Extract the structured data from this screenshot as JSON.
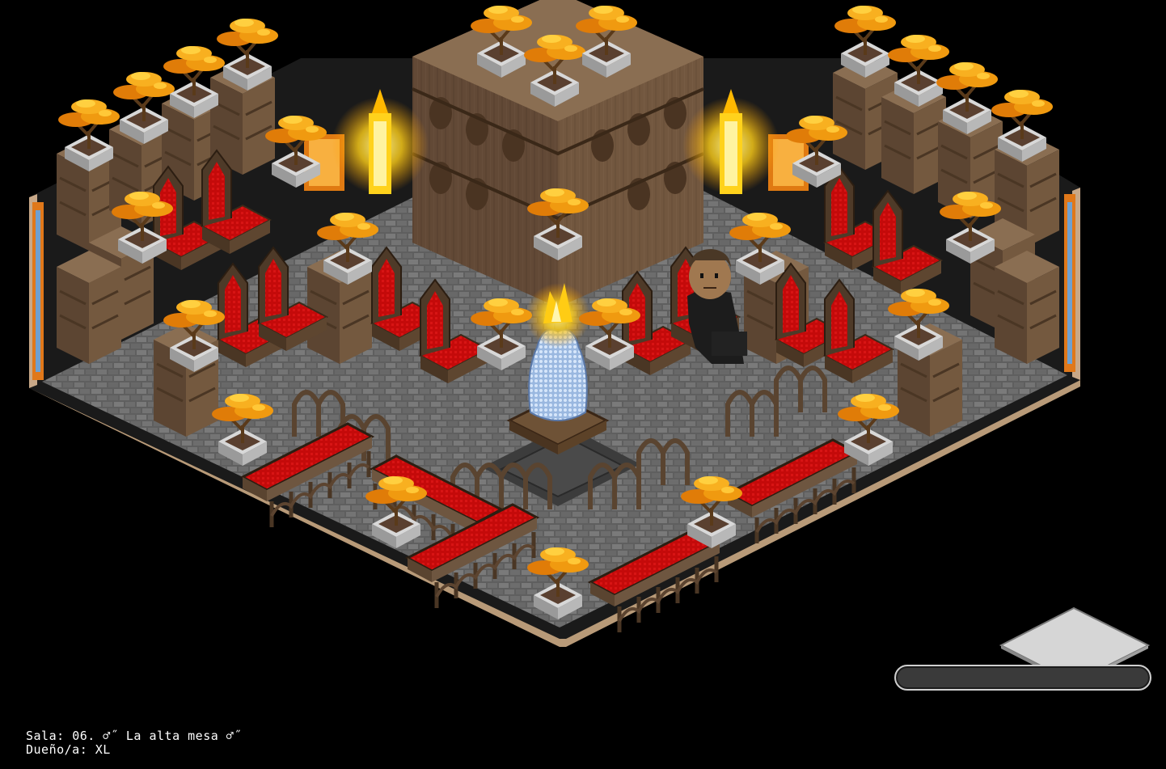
{
  "room": {
    "name_label": "Sala:",
    "name_value": "06. ♂˝ La alta mesa ♂˝",
    "owner_label": "Dueño/a:",
    "owner_value": "XL"
  },
  "colors": {
    "background": "#000000",
    "floor_stone": "#6b6b6b",
    "wood": "#6e5640",
    "velvet_red": "#c8090b",
    "bonsai_orange": "#f0a012",
    "planter_grey": "#b8b8b8",
    "fire_yellow": "#ffd21c",
    "fountain_blue": "#a8c8ec"
  },
  "icons": {
    "zoom_tile": "zoom-tile-icon",
    "chat": "chat-bar"
  }
}
